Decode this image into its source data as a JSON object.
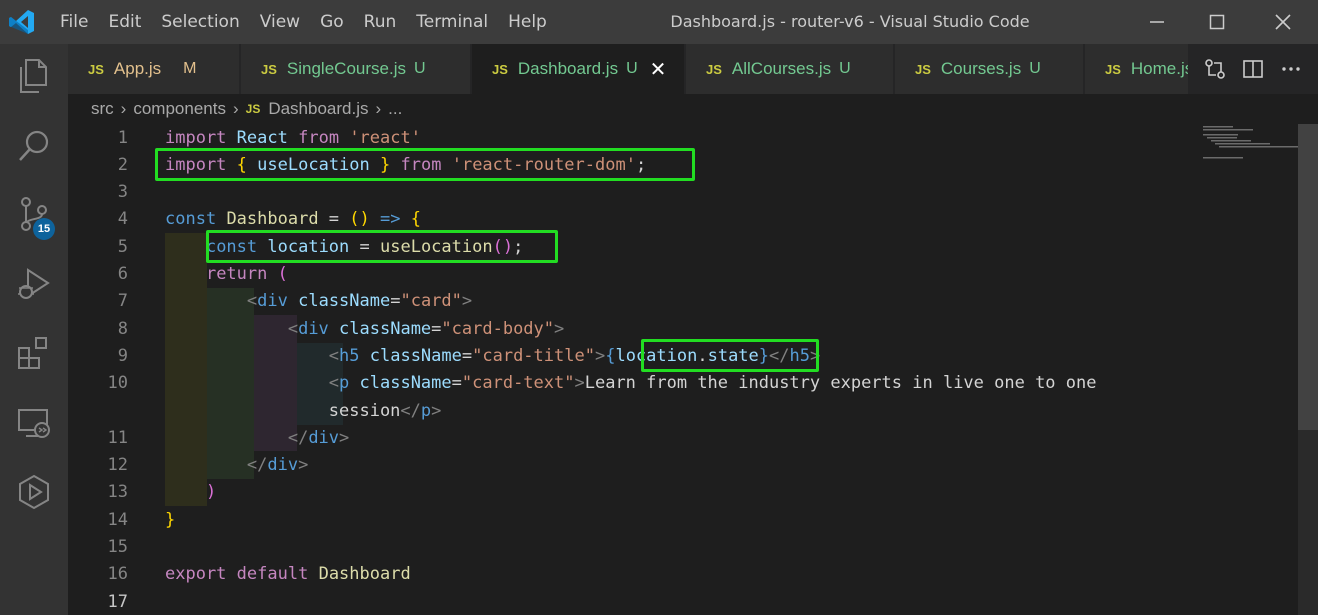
{
  "window": {
    "title": "Dashboard.js - router-v6 - Visual Studio Code",
    "menu": [
      "File",
      "Edit",
      "Selection",
      "View",
      "Go",
      "Run",
      "Terminal",
      "Help"
    ]
  },
  "activity_bar": {
    "items": [
      {
        "icon": "explorer-icon"
      },
      {
        "icon": "search-icon"
      },
      {
        "icon": "source-control-icon",
        "badge": "15"
      },
      {
        "icon": "run-debug-icon"
      },
      {
        "icon": "extensions-icon"
      },
      {
        "icon": "remote-explorer-icon"
      },
      {
        "icon": "live-share-icon"
      }
    ]
  },
  "tabs": [
    {
      "label": "App.js",
      "status": "M",
      "active": false
    },
    {
      "label": "SingleCourse.js",
      "status": "U",
      "active": false
    },
    {
      "label": "Dashboard.js",
      "status": "U",
      "active": true,
      "close": "✕"
    },
    {
      "label": "AllCourses.js",
      "status": "U",
      "active": false
    },
    {
      "label": "Courses.js",
      "status": "U",
      "active": false
    },
    {
      "label": "Home.js",
      "status": "",
      "active": false
    }
  ],
  "tab_file_badge": "JS",
  "breadcrumb": {
    "parts": [
      "src",
      "components",
      "Dashboard.js",
      "..."
    ]
  },
  "editor": {
    "language": "javascript",
    "line_numbers": [
      "1",
      "2",
      "3",
      "4",
      "5",
      "6",
      "7",
      "8",
      "9",
      "10",
      "",
      "11",
      "12",
      "13",
      "14",
      "15",
      "16",
      "17"
    ],
    "highlight_color": "#22dd22"
  },
  "colors": {
    "keyword": "#c586c0",
    "storage": "#569cd6",
    "variable": "#9cdcfe",
    "string": "#ce9178",
    "function": "#dcdcaa",
    "class": "#4ec9b0",
    "bracket": "#ffd700"
  }
}
